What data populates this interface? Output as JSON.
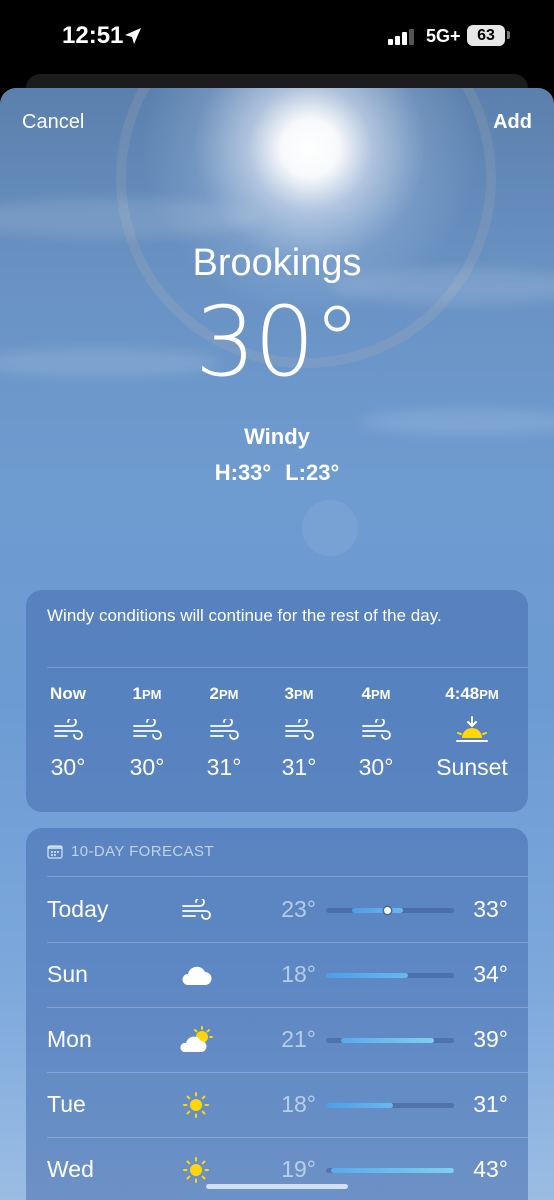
{
  "status_bar": {
    "time": "12:51",
    "network": "5G+",
    "battery": "63"
  },
  "nav": {
    "cancel_label": "Cancel",
    "add_label": "Add"
  },
  "current": {
    "city": "Brookings",
    "temperature": "30°",
    "condition": "Windy",
    "high": "H:33°",
    "low": "L:23°"
  },
  "hourly": {
    "summary": "Windy conditions will continue for the rest of the day.",
    "hours": [
      {
        "label_num": "Now",
        "label_suffix": "",
        "icon": "wind-icon",
        "temp": "30°"
      },
      {
        "label_num": "1",
        "label_suffix": "PM",
        "icon": "wind-icon",
        "temp": "30°"
      },
      {
        "label_num": "2",
        "label_suffix": "PM",
        "icon": "wind-icon",
        "temp": "31°"
      },
      {
        "label_num": "3",
        "label_suffix": "PM",
        "icon": "wind-icon",
        "temp": "31°"
      },
      {
        "label_num": "4",
        "label_suffix": "PM",
        "icon": "wind-icon",
        "temp": "30°"
      },
      {
        "label_num": "4:48",
        "label_suffix": "PM",
        "icon": "sunset-icon",
        "temp": "Sunset"
      }
    ]
  },
  "forecast": {
    "header": "10-DAY FORECAST",
    "range_min": 18,
    "range_max": 43,
    "days": [
      {
        "day": "Today",
        "icon": "wind-icon",
        "low": "23°",
        "high": "33°",
        "low_val": 23,
        "high_val": 33,
        "current_val": 30
      },
      {
        "day": "Sun",
        "icon": "cloud-icon",
        "low": "18°",
        "high": "34°",
        "low_val": 18,
        "high_val": 34
      },
      {
        "day": "Mon",
        "icon": "partly-cloudy-icon",
        "low": "21°",
        "high": "39°",
        "low_val": 21,
        "high_val": 39
      },
      {
        "day": "Tue",
        "icon": "sun-icon",
        "low": "18°",
        "high": "31°",
        "low_val": 18,
        "high_val": 31
      },
      {
        "day": "Wed",
        "icon": "sun-icon",
        "low": "19°",
        "high": "43°",
        "low_val": 19,
        "high_val": 43
      }
    ]
  },
  "colors": {
    "sky": "#6c9bd3",
    "card": "#466eaf",
    "sun": "#ffd60a",
    "bar_cool": "#5aa9ea",
    "bar_warm": "#79c5f0"
  }
}
